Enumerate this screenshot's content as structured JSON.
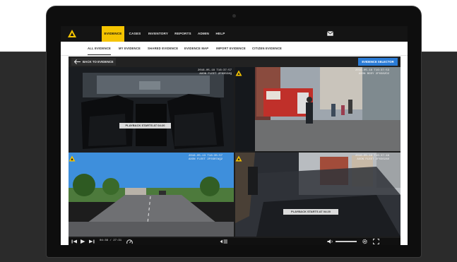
{
  "nav": {
    "items": [
      "EVIDENCE",
      "CASES",
      "INVENTORY",
      "REPORTS",
      "ADMIN",
      "HELP"
    ],
    "active": "EVIDENCE",
    "user_lines": [
      "",
      "",
      ""
    ]
  },
  "subnav": {
    "items": [
      "ALL EVIDENCE",
      "MY EVIDENCE",
      "SHARED EVIDENCE",
      "EVIDENCE MAP",
      "IMPORT EVIDENCE",
      "CITIZEN EVIDENCE"
    ],
    "active": "ALL EVIDENCE"
  },
  "toolbar": {
    "back_label": "BACK TO EVIDENCE",
    "selector_label": "EVIDENCE SELECTOR"
  },
  "panes": [
    {
      "stamp_line1": "2016-05-18 T16:37:57",
      "stamp_line2": "AXON FLEET 2F0302AQ",
      "playback": "PLAYBACK STARTS AT 04:20"
    },
    {
      "stamp_line1": "2016-05-18 T16:37:53",
      "stamp_line2": "AXON BODY 2F0382D2"
    },
    {
      "stamp_line1": "2016-05-13 T16:35:57",
      "stamp_line2": "AXON FLEET 2F0307AQ2",
      "tiny": ""
    },
    {
      "stamp_line1": "2016-05-18 T16:37:48",
      "stamp_line2": "AXON FLEET 2F0302A0",
      "playback": "PLAYBACK STARTS AT 04:20"
    }
  ],
  "player": {
    "time": "04:36 / 27:31"
  },
  "colors": {
    "accent": "#f5c400",
    "selector": "#2a7bd6",
    "background_band": "#2b2b2b"
  }
}
